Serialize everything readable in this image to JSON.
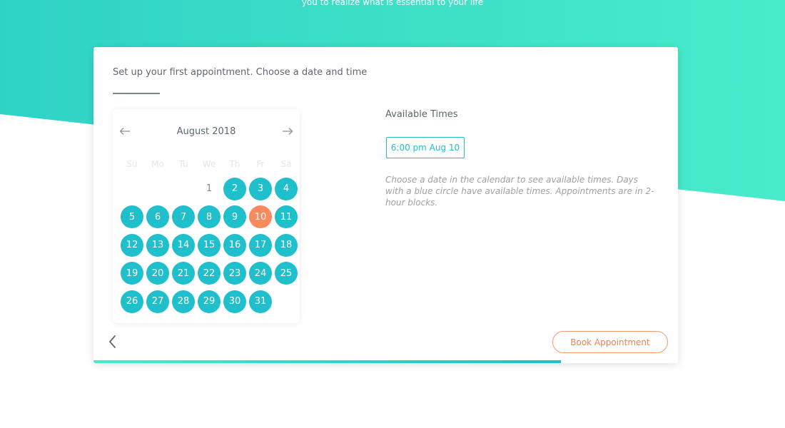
{
  "hero": {
    "tagline": "you to realize what is essential to your life"
  },
  "card": {
    "title": "Set up your first appointment. Choose a date and time"
  },
  "calendar": {
    "month_label": "August 2018",
    "prev_icon": "arrow-left-icon",
    "next_icon": "arrow-right-icon",
    "weekdays": [
      "Su",
      "Mo",
      "Tu",
      "We",
      "Th",
      "Fr",
      "Sa"
    ],
    "leading_blanks": 3,
    "days": [
      {
        "label": "1",
        "available": false
      },
      {
        "label": "2",
        "available": true
      },
      {
        "label": "3",
        "available": true
      },
      {
        "label": "4",
        "available": true
      },
      {
        "label": "5",
        "available": true
      },
      {
        "label": "6",
        "available": true
      },
      {
        "label": "7",
        "available": true
      },
      {
        "label": "8",
        "available": true
      },
      {
        "label": "9",
        "available": true
      },
      {
        "label": "10",
        "available": true,
        "selected": true
      },
      {
        "label": "11",
        "available": true
      },
      {
        "label": "12",
        "available": true
      },
      {
        "label": "13",
        "available": true
      },
      {
        "label": "14",
        "available": true
      },
      {
        "label": "15",
        "available": true
      },
      {
        "label": "16",
        "available": true
      },
      {
        "label": "17",
        "available": true
      },
      {
        "label": "18",
        "available": true
      },
      {
        "label": "19",
        "available": true
      },
      {
        "label": "20",
        "available": true
      },
      {
        "label": "21",
        "available": true
      },
      {
        "label": "22",
        "available": true
      },
      {
        "label": "23",
        "available": true
      },
      {
        "label": "24",
        "available": true
      },
      {
        "label": "25",
        "available": true
      },
      {
        "label": "26",
        "available": true
      },
      {
        "label": "27",
        "available": true
      },
      {
        "label": "28",
        "available": true
      },
      {
        "label": "29",
        "available": true
      },
      {
        "label": "30",
        "available": true
      },
      {
        "label": "31",
        "available": true
      }
    ]
  },
  "available": {
    "title": "Available Times",
    "slots": [
      "6:00 pm Aug 10"
    ],
    "help_text": "Choose a date in the calendar to see available times. Days with a blue circle have available times. Appointments are in 2-hour blocks."
  },
  "actions": {
    "back_icon": "chevron-left-icon",
    "book_label": "Book Appointment"
  },
  "progress": {
    "percent": 80
  },
  "colors": {
    "accent": "#1fbfcc",
    "selected": "#f88b5e",
    "book_button": "#f47f4f",
    "hero_start": "#2fd3c6",
    "hero_end": "#48ecca"
  }
}
